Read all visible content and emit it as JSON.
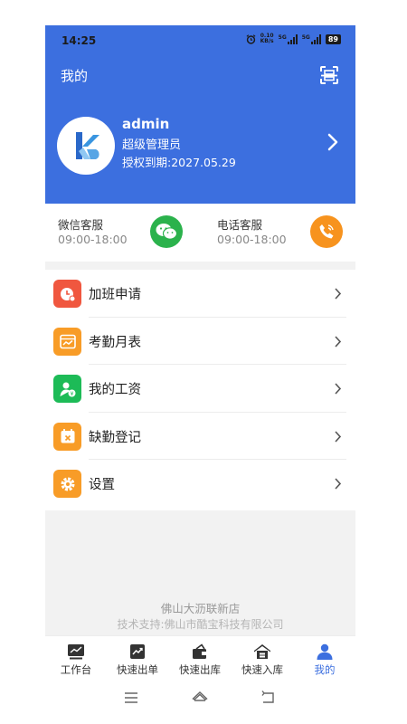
{
  "status_bar": {
    "time": "14:25",
    "net_speed_top": "0.10",
    "net_speed_bottom": "KB/s",
    "signal_1": "5G",
    "signal_2": "5G",
    "battery": "89",
    "icons": [
      "alarm-icon",
      "signal-icon",
      "battery-icon"
    ]
  },
  "header": {
    "title": "我的",
    "scan_icon": "scan-icon"
  },
  "profile": {
    "name": "admin",
    "role": "超级管理员",
    "expiry": "授权到期:2027.05.29"
  },
  "services": [
    {
      "title": "微信客服",
      "hours": "09:00-18:00",
      "icon": "wechat-icon",
      "color": "#2bb24c"
    },
    {
      "title": "电话客服",
      "hours": "09:00-18:00",
      "icon": "phone-icon",
      "color": "#f7931e"
    }
  ],
  "menu": [
    {
      "label": "加班申请",
      "icon": "overtime-icon",
      "color": "#f0573f"
    },
    {
      "label": "考勤月表",
      "icon": "calendar-chart-icon",
      "color": "#f89c27"
    },
    {
      "label": "我的工资",
      "icon": "salary-icon",
      "color": "#1dbb57"
    },
    {
      "label": "缺勤登记",
      "icon": "absence-icon",
      "color": "#f89c27"
    },
    {
      "label": "设置",
      "icon": "settings-icon",
      "color": "#f89c27"
    }
  ],
  "footer": {
    "store": "佛山大沥联新店",
    "support": "技术支持:佛山市酷宝科技有限公司"
  },
  "tabs": [
    {
      "label": "工作台",
      "icon": "dashboard-icon"
    },
    {
      "label": "快速出单",
      "icon": "trend-icon"
    },
    {
      "label": "快速出库",
      "icon": "outbound-icon"
    },
    {
      "label": "快速入库",
      "icon": "inbound-icon"
    },
    {
      "label": "我的",
      "icon": "user-icon",
      "active": true
    }
  ],
  "colors": {
    "primary": "#3c6fdf",
    "background_gray": "#f2f2f2"
  }
}
